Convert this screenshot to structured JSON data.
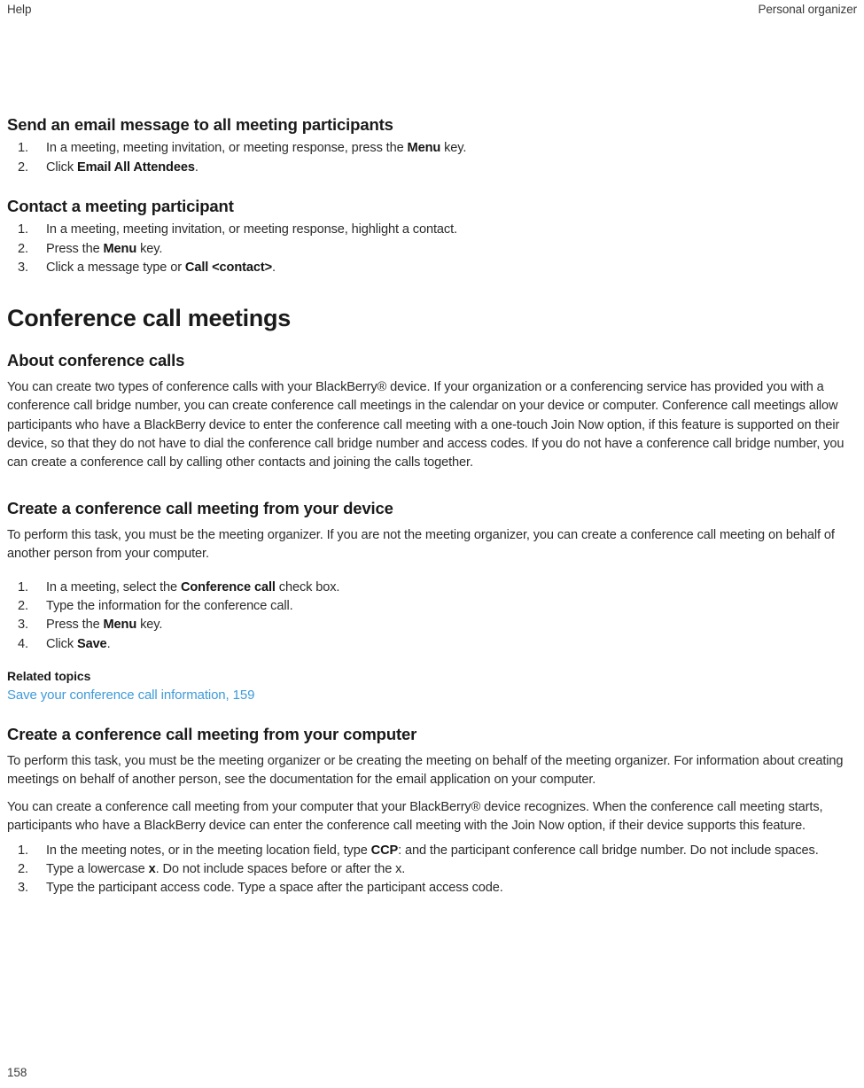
{
  "header": {
    "left": "Help",
    "right": "Personal organizer"
  },
  "footer": {
    "page_number": "158"
  },
  "colors": {
    "text": "#2b2b2b",
    "heading": "#1a1a1a",
    "link": "#3f9bd9"
  },
  "sections": [
    {
      "id": "send-email-all-participants",
      "heading": "Send an email message to all meeting participants",
      "steps": [
        {
          "num": "1.",
          "parts": [
            {
              "t": "In a meeting, meeting invitation, or meeting response, press the ",
              "b": false
            },
            {
              "t": "Menu",
              "b": true
            },
            {
              "t": " key.",
              "b": false
            }
          ]
        },
        {
          "num": "2.",
          "parts": [
            {
              "t": "Click ",
              "b": false
            },
            {
              "t": "Email All Attendees",
              "b": true
            },
            {
              "t": ".",
              "b": false
            }
          ]
        }
      ]
    },
    {
      "id": "contact-a-meeting-participant",
      "heading": "Contact a meeting participant",
      "steps": [
        {
          "num": "1.",
          "parts": [
            {
              "t": "In a meeting, meeting invitation, or meeting response, highlight a contact.",
              "b": false
            }
          ]
        },
        {
          "num": "2.",
          "parts": [
            {
              "t": "Press the ",
              "b": false
            },
            {
              "t": "Menu",
              "b": true
            },
            {
              "t": " key.",
              "b": false
            }
          ]
        },
        {
          "num": "3.",
          "parts": [
            {
              "t": "Click a message type or ",
              "b": false
            },
            {
              "t": "Call <contact>",
              "b": true
            },
            {
              "t": ".",
              "b": false
            }
          ]
        }
      ]
    }
  ],
  "chapter": {
    "title": "Conference call meetings"
  },
  "about": {
    "heading": "About conference calls",
    "paragraph": "You can create two types of conference calls with your BlackBerry® device. If your organization or a conferencing service has provided you with a conference call bridge number, you can create conference call meetings in the calendar on your device or computer. Conference call meetings allow participants who have a BlackBerry device to enter the conference call meeting with a one-touch Join Now option, if this feature is supported on their device, so that they do not have to dial the conference call bridge number and access codes. If you do not have a conference call bridge number, you can create a conference call by calling other contacts and joining the calls together."
  },
  "from_device": {
    "heading": "Create a conference call meeting from your device",
    "paragraph": "To perform this task, you must be the meeting organizer. If you are not the meeting organizer, you can create a conference call meeting on behalf of another person from your computer.",
    "steps": [
      {
        "num": "1.",
        "parts": [
          {
            "t": "In a meeting, select the ",
            "b": false
          },
          {
            "t": "Conference call",
            "b": true
          },
          {
            "t": " check box.",
            "b": false
          }
        ]
      },
      {
        "num": "2.",
        "parts": [
          {
            "t": "Type the information for the conference call.",
            "b": false
          }
        ]
      },
      {
        "num": "3.",
        "parts": [
          {
            "t": "Press the ",
            "b": false
          },
          {
            "t": "Menu",
            "b": true
          },
          {
            "t": " key.",
            "b": false
          }
        ]
      },
      {
        "num": "4.",
        "parts": [
          {
            "t": "Click ",
            "b": false
          },
          {
            "t": "Save",
            "b": true
          },
          {
            "t": ".",
            "b": false
          }
        ]
      }
    ],
    "related_label": "Related topics",
    "related_link": "Save your conference call information, 159"
  },
  "from_computer": {
    "heading": "Create a conference call meeting from your computer",
    "paragraph1": "To perform this task, you must be the meeting organizer or be creating the meeting on behalf of the meeting organizer. For information about creating meetings on behalf of another person, see the documentation for the email application on your computer.",
    "paragraph2": "You can create a conference call meeting from your computer that your BlackBerry® device recognizes. When the conference call meeting starts, participants who have a BlackBerry device can enter the conference call meeting with the Join Now option, if their device supports this feature.",
    "steps": [
      {
        "num": "1.",
        "parts": [
          {
            "t": "In the meeting notes, or in the meeting location field, type ",
            "b": false
          },
          {
            "t": "CCP",
            "b": true
          },
          {
            "t": ": and the participant conference call bridge number. Do not include spaces.",
            "b": false
          }
        ]
      },
      {
        "num": "2.",
        "parts": [
          {
            "t": "Type a lowercase ",
            "b": false
          },
          {
            "t": "x",
            "b": true
          },
          {
            "t": ". Do not include spaces before or after the x.",
            "b": false
          }
        ]
      },
      {
        "num": "3.",
        "parts": [
          {
            "t": "Type the participant access code. Type a space after the participant access code.",
            "b": false
          }
        ]
      }
    ]
  }
}
